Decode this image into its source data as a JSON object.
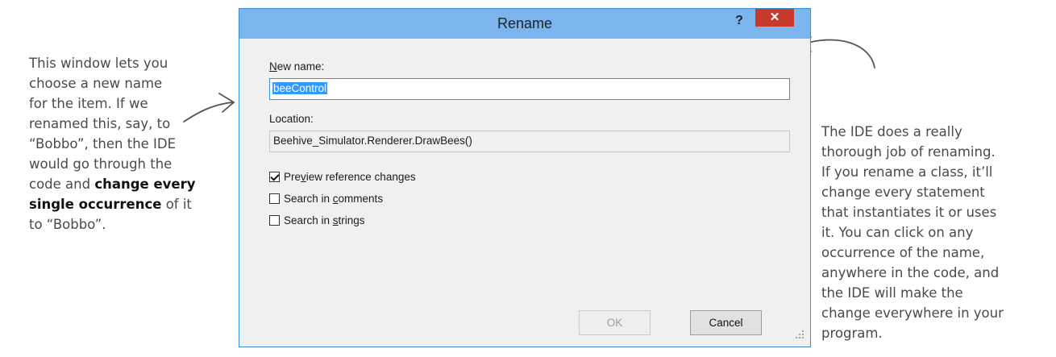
{
  "dialog": {
    "title": "Rename",
    "help_label": "?",
    "close_label": "✕",
    "new_name_label_pre": "",
    "new_name_label_key": "N",
    "new_name_label_post": "ew name:",
    "new_name_value": "beeControl",
    "location_label": "Location:",
    "location_value": "Beehive_Simulator.Renderer.DrawBees()",
    "options": [
      {
        "pre": "Pre",
        "key": "v",
        "post": "iew reference changes",
        "checked": true
      },
      {
        "pre": "Search in ",
        "key": "c",
        "post": "omments",
        "checked": false
      },
      {
        "pre": "Search in ",
        "key": "s",
        "post": "trings",
        "checked": false
      }
    ],
    "ok_label": "OK",
    "cancel_label": "Cancel"
  },
  "annotations": {
    "left_part1": "This window lets you\nchoose a new name\nfor the item. If we\nrenamed this, say, to\n“Bobbo”, then the IDE\nwould go through the\ncode and ",
    "left_bold": "change every\nsingle occurrence",
    "left_part2": " of it\nto “Bobbo”.",
    "right": "The IDE does a really\nthorough job of renaming.\nIf you rename a class, it’ll\nchange every statement\nthat instantiates it or uses\nit. You can click on any\noccurrence of the name,\nanywhere in the code, and\nthe IDE will make the\nchange everywhere in your\nprogram."
  }
}
